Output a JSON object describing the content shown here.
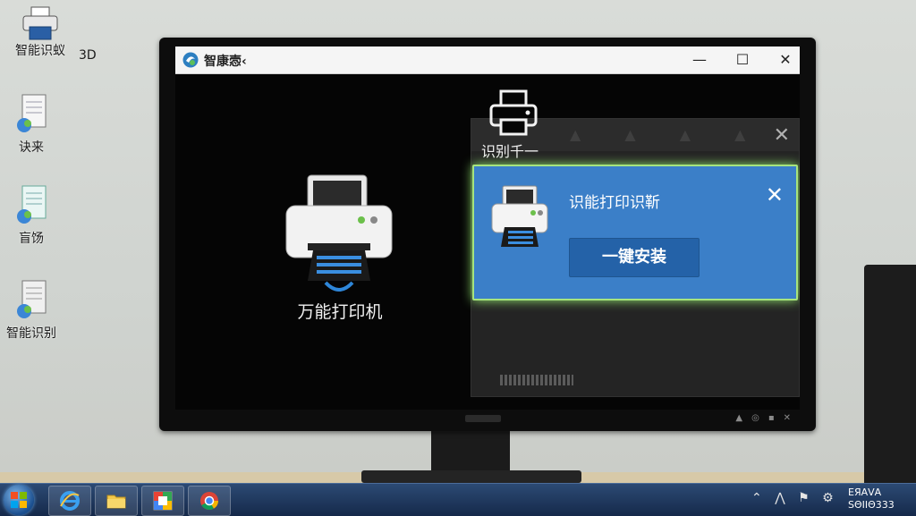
{
  "desktop": {
    "icons": [
      {
        "label": "智能识蚁",
        "icon": "printer-icon"
      },
      {
        "label": "诀来",
        "icon": "document-icon"
      },
      {
        "label": "盲饧",
        "icon": "document-icon"
      },
      {
        "label": "智能识别",
        "icon": "document-icon"
      }
    ],
    "corner_text": "3D"
  },
  "app_window": {
    "title": "智康悫‹",
    "minimize": "—",
    "maximize": "☐",
    "close": "✕",
    "main_printer_label": "万能打印机",
    "small_printer_label": "识别千一",
    "back_panel_close": "✕",
    "dialog": {
      "title": "识能打印识靳",
      "close": "✕",
      "install_button": "一键安装",
      "accent_color": "#3b7fc8",
      "glow_color": "#a7e47d"
    }
  },
  "taskbar": {
    "apps": [
      "ie-icon",
      "folder-icon",
      "media-icon",
      "chrome-icon"
    ],
    "tray_icons": [
      "chevron-up-icon",
      "network-icon",
      "flag-icon",
      "gear-icon"
    ],
    "clock_line1": "ЕЯАVА",
    "clock_line2": "SΘΙΙΘ333"
  }
}
